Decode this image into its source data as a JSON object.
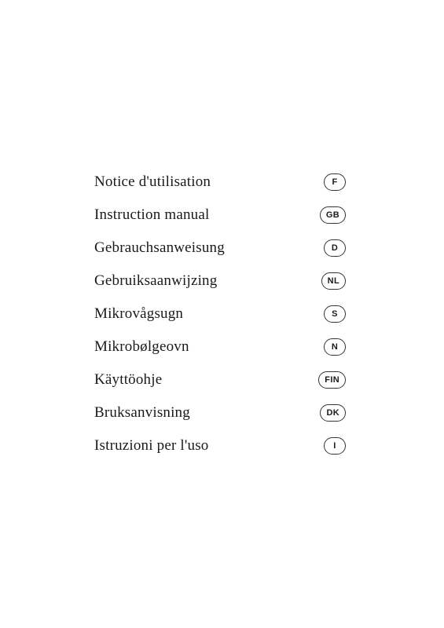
{
  "items": [
    {
      "label": "Notice d'utilisation",
      "badge": "F",
      "id": "item-french"
    },
    {
      "label": "Instruction manual",
      "badge": "GB",
      "id": "item-english"
    },
    {
      "label": "Gebrauchsanweisung",
      "badge": "D",
      "id": "item-german"
    },
    {
      "label": "Gebruiksaanwijzing",
      "badge": "NL",
      "id": "item-dutch"
    },
    {
      "label": "Mikrovågsugn",
      "badge": "S",
      "id": "item-swedish"
    },
    {
      "label": "Mikrobølgeovn",
      "badge": "N",
      "id": "item-norwegian"
    },
    {
      "label": "Käyttöohje",
      "badge": "FIN",
      "id": "item-finnish"
    },
    {
      "label": "Bruksanvisning",
      "badge": "DK",
      "id": "item-danish"
    },
    {
      "label": "Istruzioni per l'uso",
      "badge": "I",
      "id": "item-italian"
    }
  ]
}
